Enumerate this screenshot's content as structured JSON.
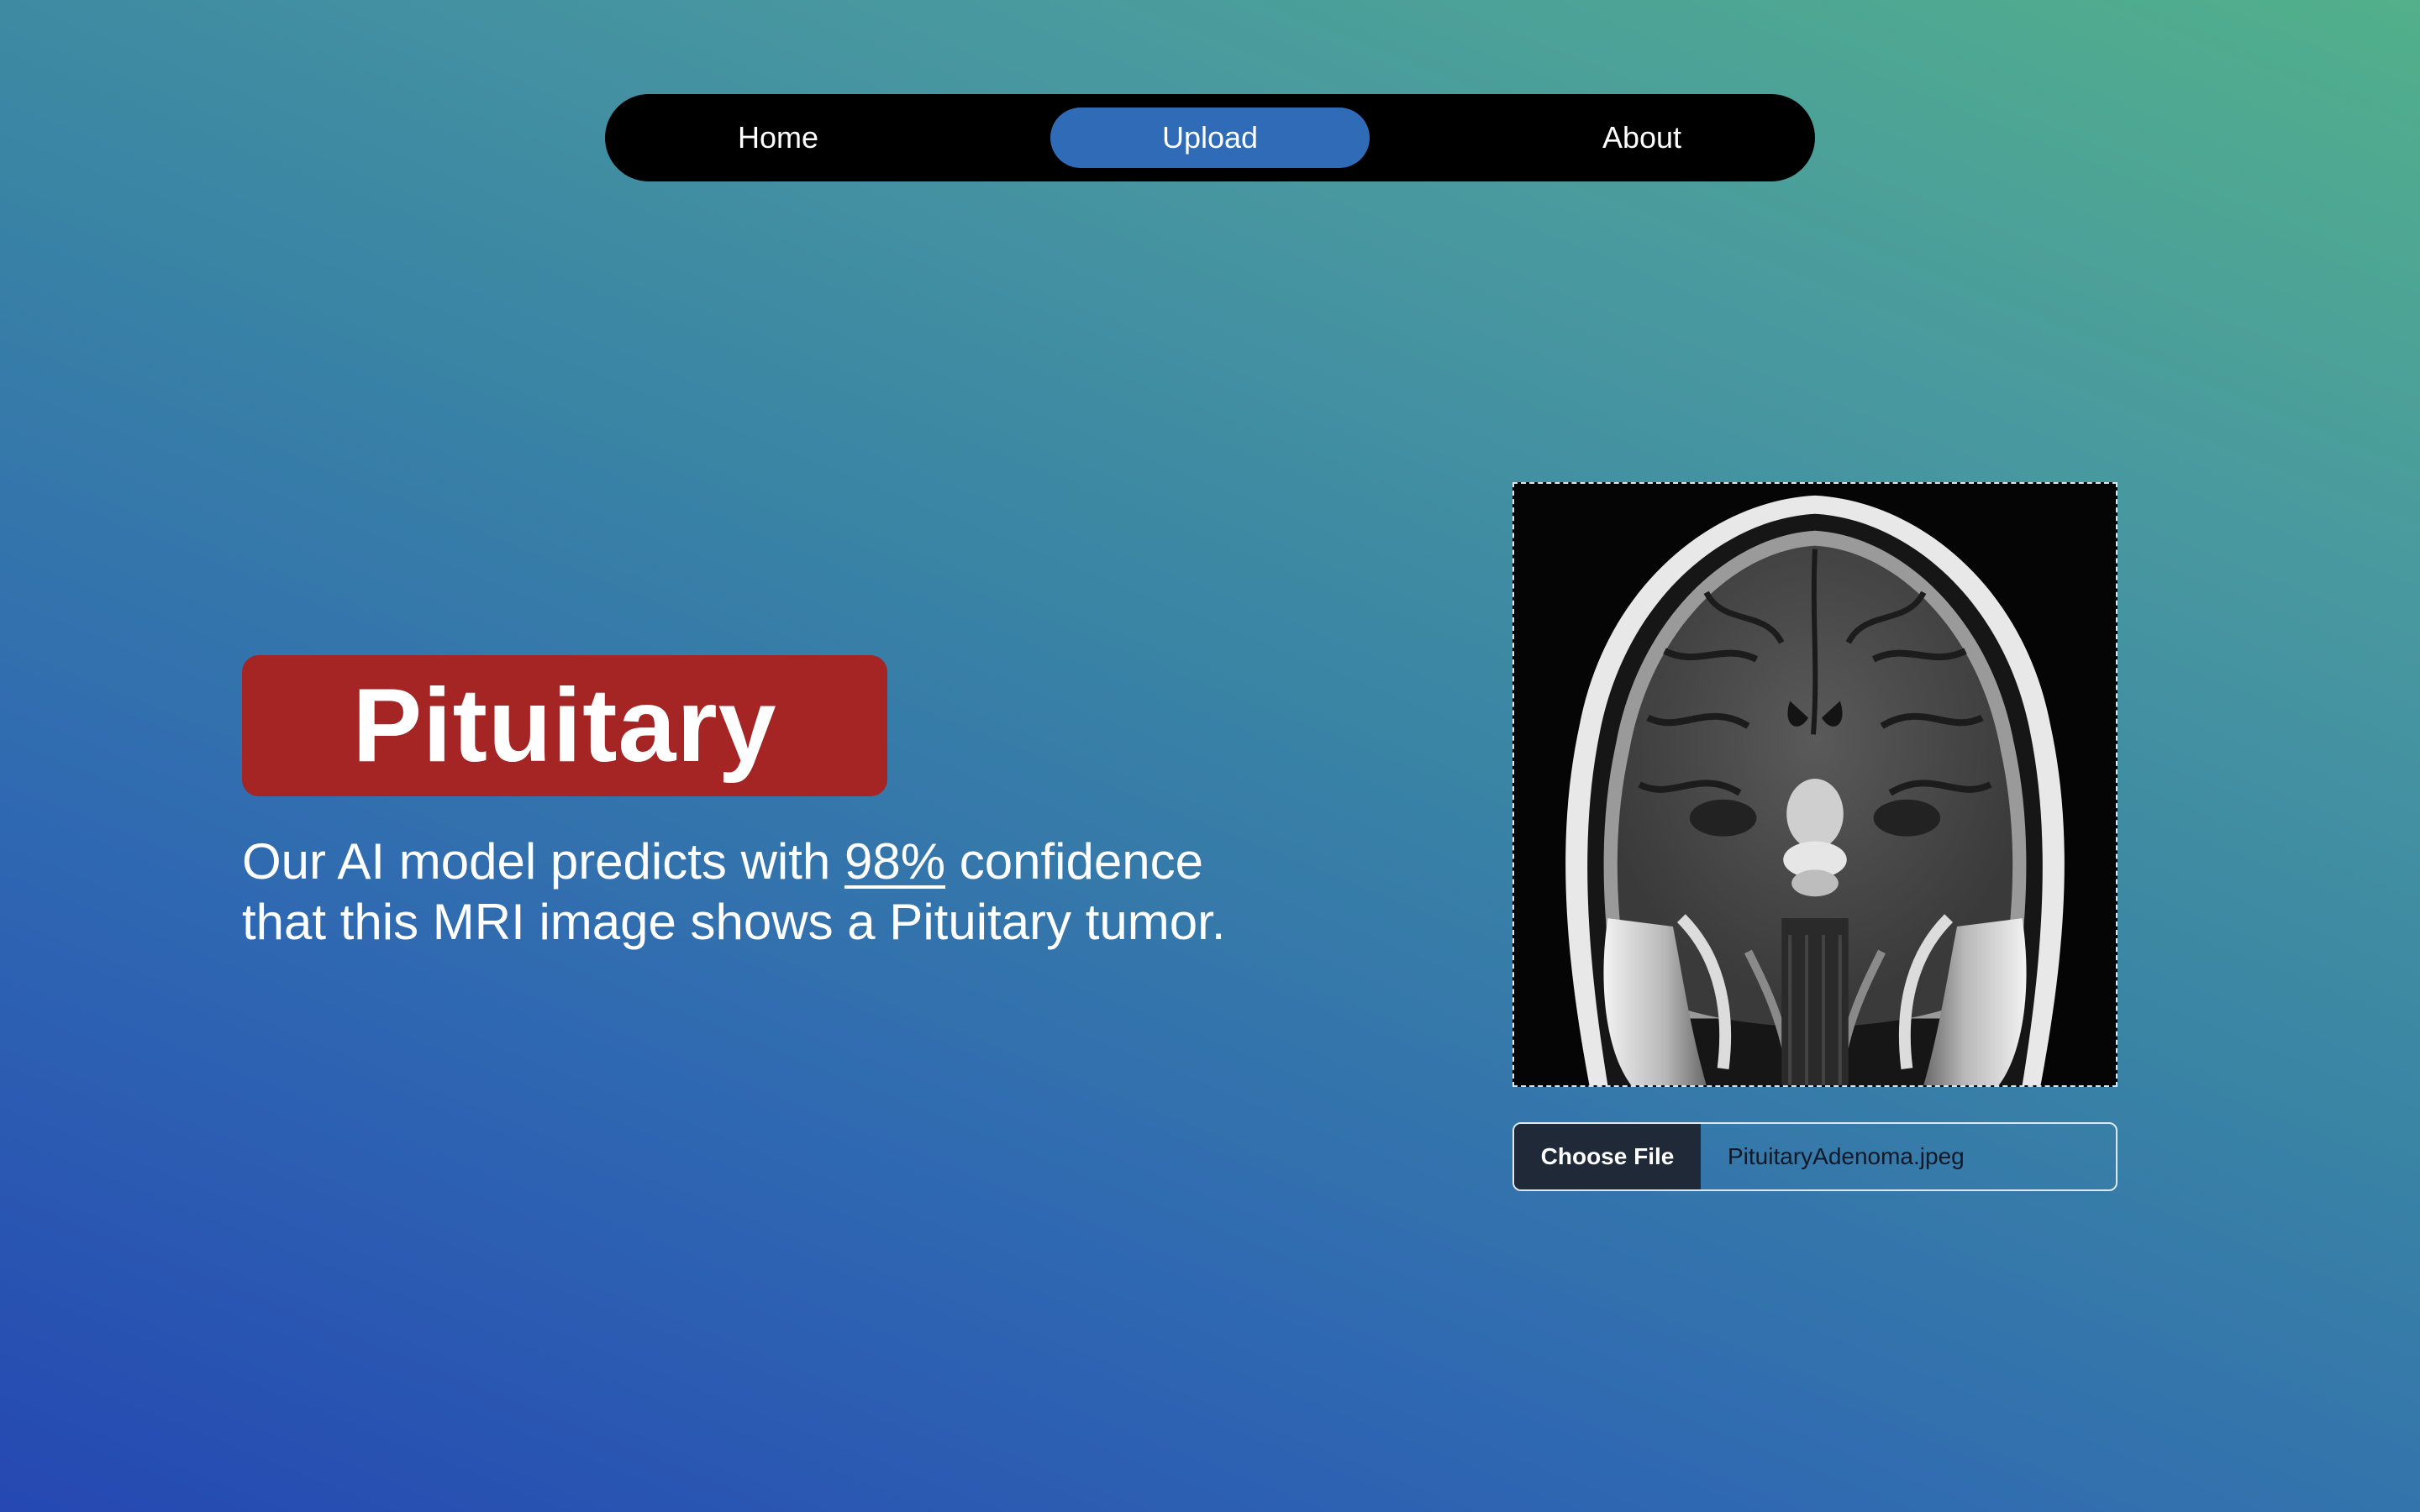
{
  "nav": {
    "items": [
      {
        "label": "Home",
        "active": false
      },
      {
        "label": "Upload",
        "active": true
      },
      {
        "label": "About",
        "active": false
      }
    ],
    "active_color": "#2f6bb6"
  },
  "result": {
    "label": "Pituitary",
    "badge_color": "#a52424",
    "text_before": "Our AI model predicts with ",
    "confidence": "98%",
    "text_after": " confidence that this MRI image shows a Pituitary tumor."
  },
  "upload": {
    "button_label": "Choose File",
    "file_name": "PituitaryAdenoma.jpeg"
  }
}
